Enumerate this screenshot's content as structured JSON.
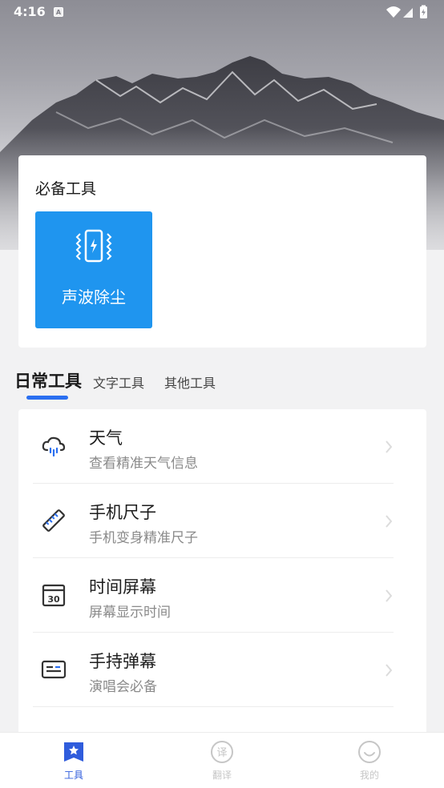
{
  "status_bar": {
    "time": "4:16",
    "notification_badge": "A"
  },
  "hero": {
    "image": "mountain-landscape"
  },
  "essential_tools": {
    "title": "必备工具",
    "tiles": [
      {
        "label": "声波除尘",
        "icon": "vibrating-phone-icon",
        "color": "#1f95ef"
      }
    ]
  },
  "tabs": {
    "items": [
      "日常工具",
      "文字工具",
      "其他工具"
    ],
    "active_index": 0,
    "indicator_color": "#2a6ff0"
  },
  "tool_list": [
    {
      "title": "天气",
      "subtitle": "查看精准天气信息",
      "icon": "cloud-rain-icon"
    },
    {
      "title": "手机尺子",
      "subtitle": "手机变身精准尺子",
      "icon": "ruler-icon"
    },
    {
      "title": "时间屏幕",
      "subtitle": "屏幕显示时间",
      "icon": "calendar-30-icon"
    },
    {
      "title": "手持弹幕",
      "subtitle": "演唱会必备",
      "icon": "marquee-card-icon"
    }
  ],
  "bottom_nav": {
    "items": [
      {
        "label": "工具",
        "icon": "bookmark-star-icon",
        "active": true
      },
      {
        "label": "翻译",
        "icon": "translate-circle-icon",
        "active": false
      },
      {
        "label": "我的",
        "icon": "smile-circle-icon",
        "active": false
      }
    ],
    "active_color": "#2f5cdc",
    "inactive_color": "#c6c6c6"
  }
}
